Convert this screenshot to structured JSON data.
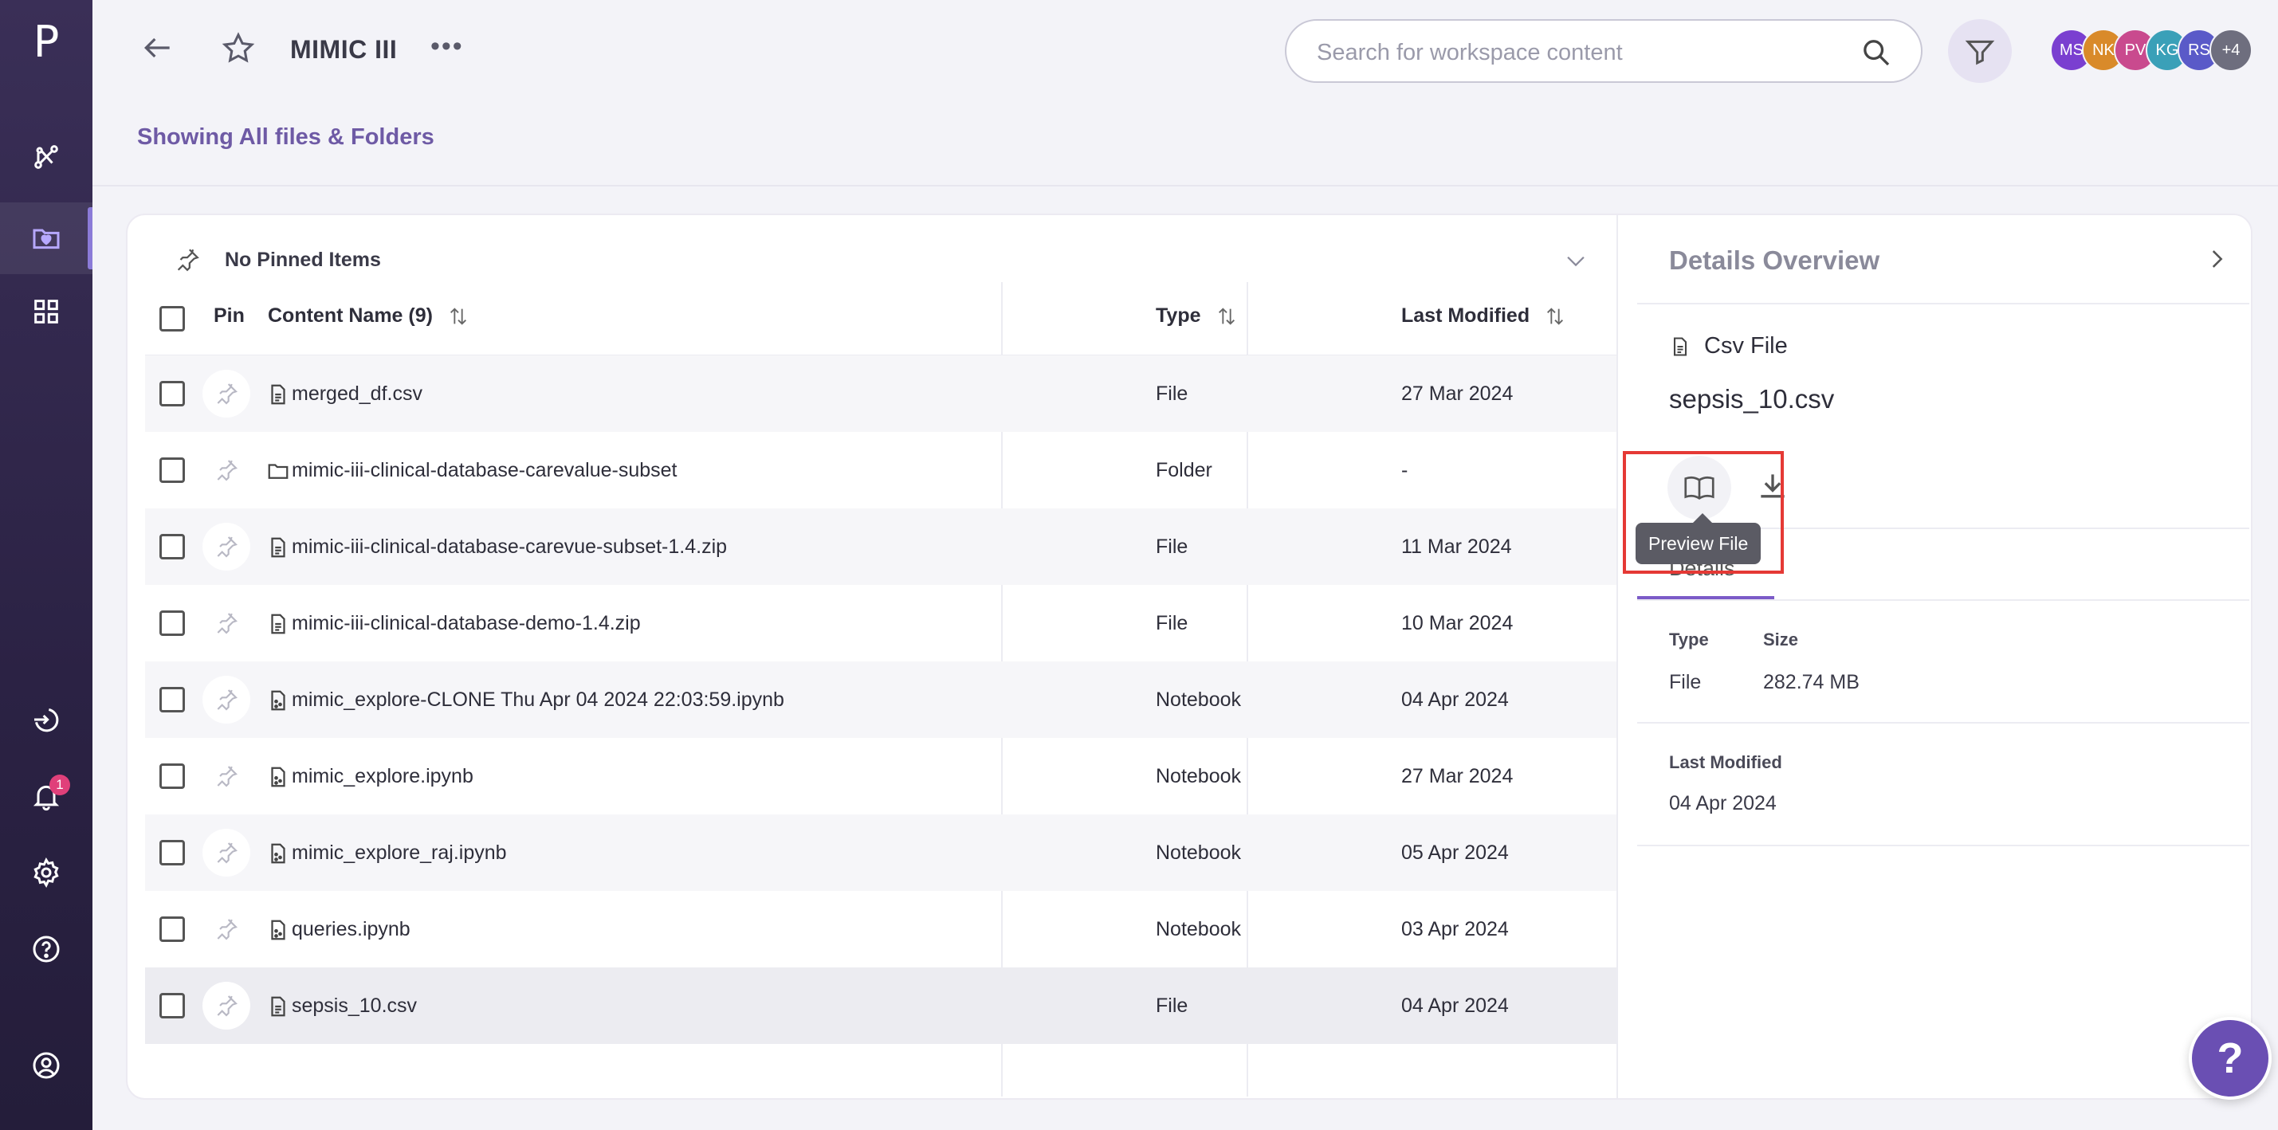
{
  "sidebar": {
    "logo": "P",
    "notification_count": "1",
    "items": [
      {
        "name": "pipeline-icon"
      },
      {
        "name": "workspace-icon"
      },
      {
        "name": "apps-grid-icon"
      },
      {
        "name": "import-icon"
      },
      {
        "name": "bell-icon"
      },
      {
        "name": "gear-icon"
      },
      {
        "name": "help-circle-icon"
      },
      {
        "name": "user-profile-icon"
      }
    ]
  },
  "header": {
    "title": "MIMIC III",
    "more": "•••",
    "search_placeholder": "Search for workspace content",
    "avatars": [
      {
        "initials": "MS",
        "color": "#7a3fd0"
      },
      {
        "initials": "NK",
        "color": "#d98a2a"
      },
      {
        "initials": "PV",
        "color": "#c94a8e"
      },
      {
        "initials": "KG",
        "color": "#3aa0b8"
      },
      {
        "initials": "RS",
        "color": "#5a5ac8"
      },
      {
        "initials": "+4",
        "color": "#6e6e7e"
      }
    ]
  },
  "subheading": "Showing All files & Folders",
  "pinned": {
    "label": "No Pinned Items"
  },
  "table": {
    "headers": {
      "pin": "Pin",
      "name": "Content Name (9)",
      "type": "Type",
      "modified": "Last Modified"
    },
    "rows": [
      {
        "name": "merged_df.csv",
        "type": "File",
        "modified": "27 Mar 2024",
        "icon": "file-icon"
      },
      {
        "name": "mimic-iii-clinical-database-carevalue-subset",
        "type": "Folder",
        "modified": "-",
        "icon": "folder-icon"
      },
      {
        "name": "mimic-iii-clinical-database-carevue-subset-1.4.zip",
        "type": "File",
        "modified": "11 Mar 2024",
        "icon": "file-icon"
      },
      {
        "name": "mimic-iii-clinical-database-demo-1.4.zip",
        "type": "File",
        "modified": "10 Mar 2024",
        "icon": "file-icon"
      },
      {
        "name": "mimic_explore-CLONE Thu Apr 04 2024 22:03:59.ipynb",
        "type": "Notebook",
        "modified": "04 Apr 2024",
        "icon": "notebook-icon"
      },
      {
        "name": "mimic_explore.ipynb",
        "type": "Notebook",
        "modified": "27 Mar 2024",
        "icon": "notebook-icon"
      },
      {
        "name": "mimic_explore_raj.ipynb",
        "type": "Notebook",
        "modified": "05 Apr 2024",
        "icon": "notebook-icon"
      },
      {
        "name": "queries.ipynb",
        "type": "Notebook",
        "modified": "03 Apr 2024",
        "icon": "notebook-icon"
      },
      {
        "name": "sepsis_10.csv",
        "type": "File",
        "modified": "04 Apr 2024",
        "icon": "file-icon"
      }
    ]
  },
  "details": {
    "title": "Details Overview",
    "file_type": "Csv File",
    "file_name": "sepsis_10.csv",
    "tooltip": "Preview File",
    "tab": "Details",
    "type_label": "Type",
    "type_value": "File",
    "size_label": "Size",
    "size_value": "282.74 MB",
    "modified_label": "Last Modified",
    "modified_value": "04 Apr 2024"
  },
  "help_fab": "?"
}
